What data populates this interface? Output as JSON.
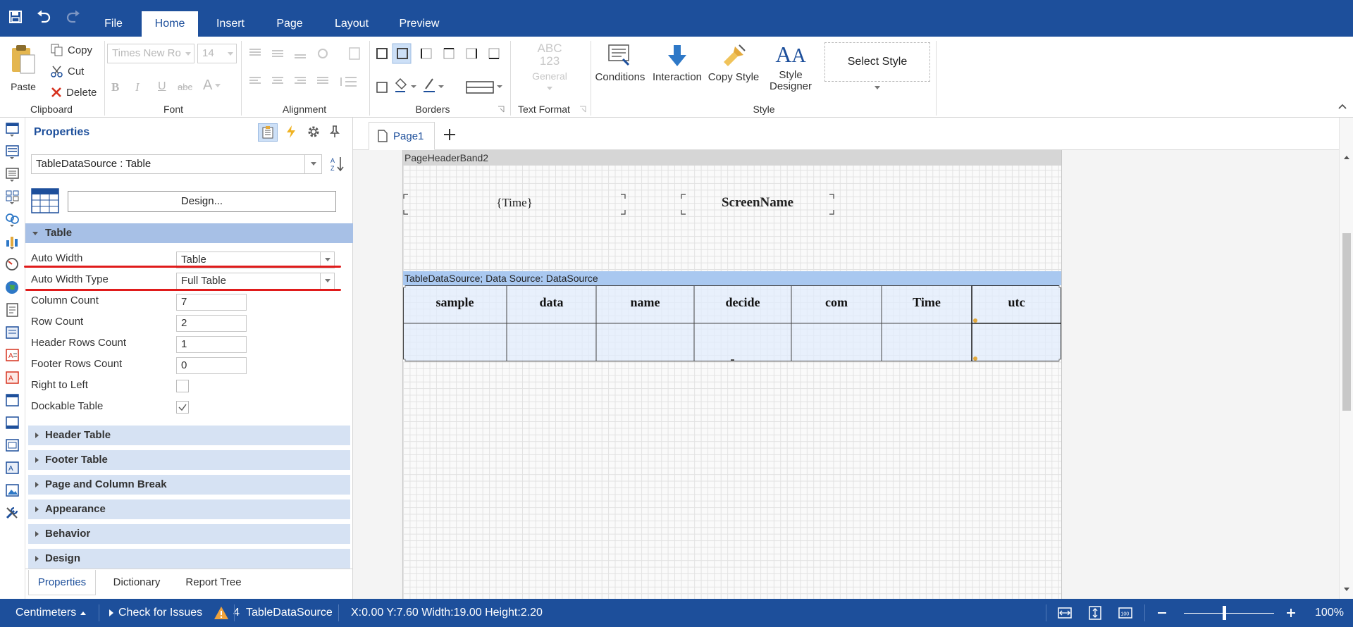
{
  "menubar": {
    "tabs": [
      "File",
      "Home",
      "Insert",
      "Page",
      "Layout",
      "Preview"
    ],
    "active_tab": "Home"
  },
  "ribbon": {
    "clipboard": {
      "paste": "Paste",
      "copy": "Copy",
      "cut": "Cut",
      "delete": "Delete",
      "label": "Clipboard"
    },
    "font": {
      "family": "Times New Ro",
      "size": "14",
      "label": "Font"
    },
    "alignment": {
      "label": "Alignment"
    },
    "borders": {
      "label": "Borders"
    },
    "text_format": {
      "abc": "ABC",
      "num": "123",
      "general": "General",
      "label": "Text Format"
    },
    "style": {
      "conditions": "Conditions",
      "interaction": "Interaction",
      "copy_style": "Copy Style",
      "style_designer_1": "Style",
      "style_designer_2": "Designer",
      "select_style": "Select Style",
      "label": "Style"
    }
  },
  "properties": {
    "title": "Properties",
    "component": "TableDataSource : Table",
    "design_button": "Design...",
    "table_section": "Table",
    "rows": [
      {
        "label": "Auto Width",
        "value": "Table",
        "kind": "dropdown"
      },
      {
        "label": "Auto Width Type",
        "value": "Full Table",
        "kind": "dropdown"
      },
      {
        "label": "Column Count",
        "value": "7",
        "kind": "text"
      },
      {
        "label": "Row Count",
        "value": "2",
        "kind": "text"
      },
      {
        "label": "Header Rows Count",
        "value": "1",
        "kind": "text"
      },
      {
        "label": "Footer Rows Count",
        "value": "0",
        "kind": "text"
      },
      {
        "label": "Right to Left",
        "value": "",
        "kind": "checkbox",
        "checked": false
      },
      {
        "label": "Dockable Table",
        "value": "",
        "kind": "checkbox",
        "checked": true
      }
    ],
    "sections": [
      "Header Table",
      "Footer Table",
      "Page and Column Break",
      "Appearance",
      "Behavior",
      "Design"
    ],
    "bottom_tabs": [
      "Properties",
      "Dictionary",
      "Report Tree"
    ],
    "active_bottom_tab": "Properties"
  },
  "designer": {
    "page_tab": "Page1",
    "header_band": "PageHeaderBand2",
    "time_text": "{Time}",
    "screen_name": "ScreenName",
    "data_band": "TableDataSource; Data Source: DataSource",
    "columns": [
      "sample",
      "data",
      "name",
      "decide",
      "com",
      "Time",
      "utc"
    ]
  },
  "statusbar": {
    "units": "Centimeters",
    "check_issues": "Check for Issues",
    "issues_count": "4",
    "component": "TableDataSource",
    "coords": "X:0.00 Y:7.60 Width:19.00 Height:2.20",
    "zoom": "100%"
  },
  "colors": {
    "brand": "#1d4f9b",
    "section": "#d6e2f3",
    "data_band": "#a9c8f0",
    "highlight": "#e01b1b"
  }
}
